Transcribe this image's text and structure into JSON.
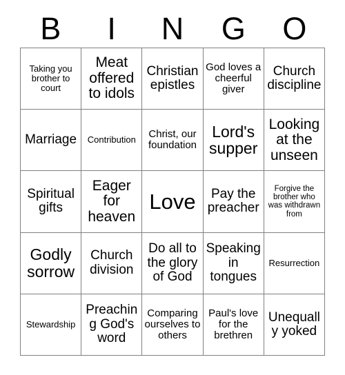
{
  "card": {
    "header": {
      "letters": [
        "B",
        "I",
        "N",
        "G",
        "O"
      ]
    },
    "grid": {
      "columns": 5,
      "rows": 5,
      "border_color": "#808080",
      "background_color": "#ffffff",
      "text_color": "#000000",
      "cells": [
        {
          "text": "Taking you brother to court",
          "size": "xs"
        },
        {
          "text": "Meat offered to idols",
          "size": "lg"
        },
        {
          "text": "Christian epistles",
          "size": "md"
        },
        {
          "text": "God loves a cheerful giver",
          "size": "sm"
        },
        {
          "text": "Church discipline",
          "size": "md"
        },
        {
          "text": "Marriage",
          "size": "md"
        },
        {
          "text": "Contribution",
          "size": "xs"
        },
        {
          "text": "Christ, our foundation",
          "size": "sm"
        },
        {
          "text": "Lord's supper",
          "size": "xl"
        },
        {
          "text": "Looking at the unseen",
          "size": "lg"
        },
        {
          "text": "Spiritual gifts",
          "size": "md"
        },
        {
          "text": "Eager for heaven",
          "size": "lg"
        },
        {
          "text": "Love",
          "size": "xxl"
        },
        {
          "text": "Pay the preacher",
          "size": "md"
        },
        {
          "text": "Forgive the brother who was withdrawn from",
          "size": "xxs"
        },
        {
          "text": "Godly sorrow",
          "size": "xl"
        },
        {
          "text": "Church division",
          "size": "md"
        },
        {
          "text": "Do all to the glory of God",
          "size": "md"
        },
        {
          "text": "Speaking in tongues",
          "size": "md"
        },
        {
          "text": "Resurrection",
          "size": "xs"
        },
        {
          "text": "Stewardship",
          "size": "xs"
        },
        {
          "text": "Preaching God's word",
          "size": "md"
        },
        {
          "text": "Comparing ourselves to others",
          "size": "sm"
        },
        {
          "text": "Paul's love for the brethren",
          "size": "sm"
        },
        {
          "text": "Unequally yoked",
          "size": "md"
        }
      ]
    }
  }
}
